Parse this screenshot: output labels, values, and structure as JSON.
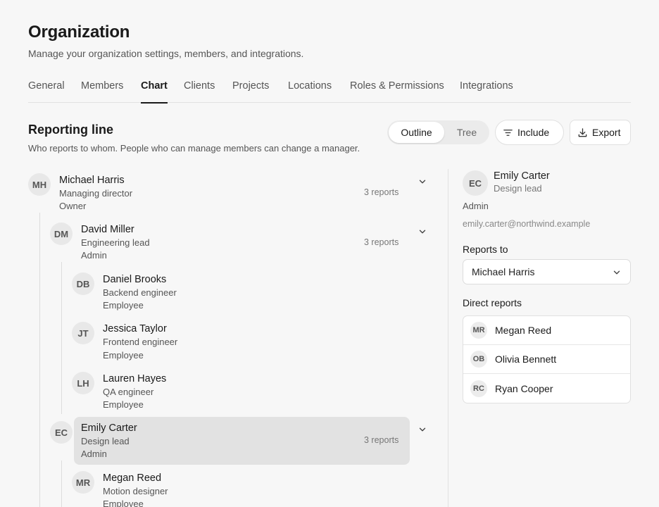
{
  "header": {
    "title": "Organization",
    "subtitle": "Manage your organization settings, members, and integrations."
  },
  "tabs": [
    {
      "label": "General",
      "active": false
    },
    {
      "label": "Members",
      "active": false
    },
    {
      "label": "Chart",
      "active": true
    },
    {
      "label": "Clients",
      "active": false
    },
    {
      "label": "Projects",
      "active": false
    },
    {
      "label": "Locations",
      "active": false
    },
    {
      "label": "Roles & Permissions",
      "active": false
    },
    {
      "label": "Integrations",
      "active": false
    }
  ],
  "section": {
    "title": "Reporting line",
    "description": "Who reports to whom. People who can manage members can change a manager."
  },
  "view_toggle": {
    "outline": "Outline",
    "tree": "Tree",
    "selected": "Outline"
  },
  "actions": {
    "include": "Include",
    "export": "Export"
  },
  "tree": [
    {
      "initials": "MH",
      "name": "Michael Harris",
      "role": "Managing director",
      "permission": "Owner",
      "reports": "3 reports",
      "expanded": true
    },
    {
      "initials": "DM",
      "name": "David Miller",
      "role": "Engineering lead",
      "permission": "Admin",
      "reports": "3 reports",
      "expanded": true
    },
    {
      "initials": "DB",
      "name": "Daniel Brooks",
      "role": "Backend engineer",
      "permission": "Employee"
    },
    {
      "initials": "JT",
      "name": "Jessica Taylor",
      "role": "Frontend engineer",
      "permission": "Employee"
    },
    {
      "initials": "LH",
      "name": "Lauren Hayes",
      "role": "QA engineer",
      "permission": "Employee"
    },
    {
      "initials": "EC",
      "name": "Emily Carter",
      "role": "Design lead",
      "permission": "Admin",
      "reports": "3 reports",
      "expanded": true,
      "selected": true
    },
    {
      "initials": "MR",
      "name": "Megan Reed",
      "role": "Motion designer",
      "permission": "Employee"
    }
  ],
  "detail": {
    "initials": "EC",
    "name": "Emily Carter",
    "role": "Design lead",
    "permission": "Admin",
    "email": "emily.carter@northwind.example",
    "reports_to_label": "Reports to",
    "reports_to_value": "Michael Harris",
    "direct_reports_label": "Direct reports",
    "direct_reports": [
      {
        "initials": "MR",
        "name": "Megan Reed"
      },
      {
        "initials": "OB",
        "name": "Olivia Bennett"
      },
      {
        "initials": "RC",
        "name": "Ryan Cooper"
      }
    ]
  },
  "colors": {
    "accent": "#1a1a1a",
    "selected_row": "#e2e2e2",
    "background": "#f7f7f7"
  }
}
